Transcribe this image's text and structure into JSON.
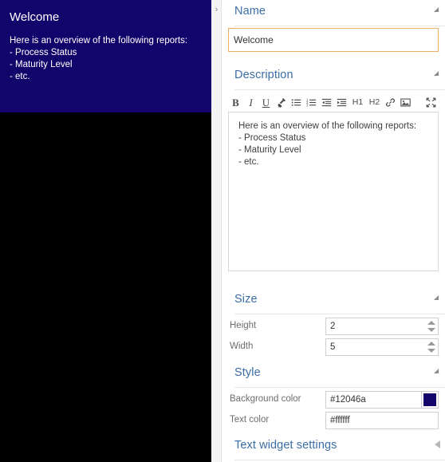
{
  "canvas": {
    "widget": {
      "title": "Welcome",
      "lines": [
        "Here is an overview of the following reports:",
        "- Process Status",
        "- Maturity Level",
        "- etc."
      ],
      "background_color": "#12046a",
      "text_color": "#ffffff"
    },
    "background_color": "#000000"
  },
  "splitter": {
    "collapse_glyph": "›"
  },
  "panel": {
    "sections": {
      "name": {
        "title": "Name",
        "value": "Welcome",
        "placeholder": "",
        "collapse_state": "expanded"
      },
      "description": {
        "title": "Description",
        "collapse_state": "expanded",
        "toolbar": [
          {
            "name": "bold-icon",
            "label": "B"
          },
          {
            "name": "italic-icon",
            "label": "I"
          },
          {
            "name": "underline-icon",
            "label": "U"
          },
          {
            "name": "format-painter-icon",
            "label": ""
          },
          {
            "name": "unordered-list-icon",
            "label": ""
          },
          {
            "name": "ordered-list-icon",
            "label": ""
          },
          {
            "name": "outdent-icon",
            "label": ""
          },
          {
            "name": "indent-icon",
            "label": ""
          },
          {
            "name": "heading-1-icon",
            "label": "H1"
          },
          {
            "name": "heading-2-icon",
            "label": "H2"
          },
          {
            "name": "link-icon",
            "label": ""
          },
          {
            "name": "image-icon",
            "label": ""
          },
          {
            "name": "fullscreen-icon",
            "label": ""
          }
        ],
        "content_lines": [
          "Here is an overview of the following reports:",
          "- Process Status",
          "- Maturity Level",
          "- etc."
        ]
      },
      "size": {
        "title": "Size",
        "collapse_state": "expanded",
        "height_label": "Height",
        "height_value": "2",
        "width_label": "Width",
        "width_value": "5"
      },
      "style": {
        "title": "Style",
        "collapse_state": "expanded",
        "background_label": "Background color",
        "background_value": "#12046a",
        "background_swatch": "#12046a",
        "text_label": "Text color",
        "text_value": "#ffffff",
        "text_swatch": "#ffffff"
      },
      "text_widget_settings": {
        "title": "Text widget settings",
        "collapse_state": "collapsed"
      }
    }
  }
}
